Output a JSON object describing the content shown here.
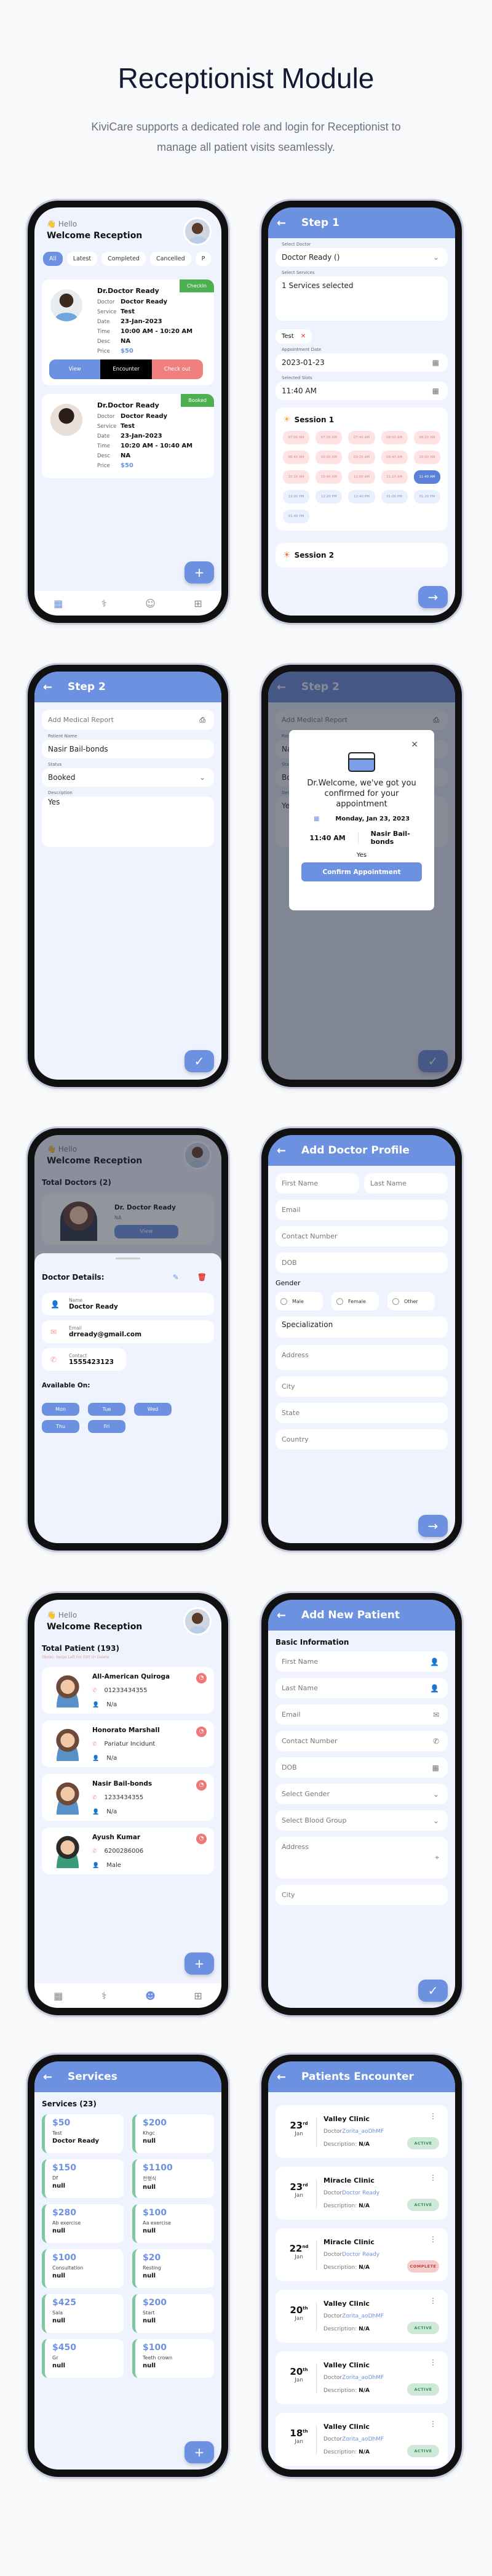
{
  "header": {
    "title": "Receptionist Module",
    "subtitle": "KiviCare supports a dedicated role and login for Receptionist to manage all patient visits seamlessly."
  },
  "colors": {
    "primary": "#6c91e0",
    "success": "#4caf50",
    "danger": "#f08080",
    "background": "#eef3fe"
  },
  "dashboard": {
    "hello": "Hello",
    "welcome": "Welcome Reception",
    "filters": [
      "All",
      "Latest",
      "Completed",
      "Cancelled",
      "P"
    ],
    "active_filter": "All",
    "appointments": [
      {
        "badge": "CheckIn",
        "name": "Dr.Doctor Ready",
        "doctor_label": "Doctor",
        "doctor": "Doctor Ready",
        "service_label": "Service",
        "service": "Test",
        "date_label": "Date",
        "date": "23-Jan-2023",
        "time_label": "Time",
        "time": "10:00 AM - 10:20 AM",
        "desc_label": "Desc",
        "desc": "NA",
        "price_label": "Price",
        "price": "$50"
      },
      {
        "badge": "Booked",
        "name": "Dr.Doctor Ready",
        "doctor_label": "Doctor",
        "doctor": "Doctor Ready",
        "service_label": "Service",
        "service": "Test",
        "date_label": "Date",
        "date": "23-Jan-2023",
        "time_label": "Time",
        "time": "10:20 AM - 10:40 AM",
        "desc_label": "Desc",
        "desc": "NA",
        "price_label": "Price",
        "price": "$50"
      }
    ],
    "actions": {
      "view": "View",
      "encounter": "Encounter",
      "checkout": "Check out"
    },
    "fab": "+"
  },
  "step1": {
    "title": "Step 1",
    "doctor_label": "Select Doctor",
    "doctor_value": "Doctor Ready ()",
    "services_label": "Select Services",
    "services_value": "1 Services selected",
    "service_chip": "Test",
    "date_label": "Appointment Date",
    "date_value": "2023-01-23",
    "slot_label": "Selected Slots",
    "slot_value": "11:40 AM",
    "session1": "Session 1",
    "session2": "Session 2",
    "slots": [
      {
        "t": "07:00 AM",
        "s": "booked"
      },
      {
        "t": "07:20 AM",
        "s": "booked"
      },
      {
        "t": "07:40 AM",
        "s": "booked"
      },
      {
        "t": "08:00 AM",
        "s": "booked"
      },
      {
        "t": "08:20 AM",
        "s": "booked"
      },
      {
        "t": "08:40 AM",
        "s": "booked"
      },
      {
        "t": "09:00 AM",
        "s": "booked"
      },
      {
        "t": "09:20 AM",
        "s": "booked"
      },
      {
        "t": "09:40 AM",
        "s": "booked"
      },
      {
        "t": "10:00 AM",
        "s": "booked"
      },
      {
        "t": "10:20 AM",
        "s": "booked"
      },
      {
        "t": "10:40 AM",
        "s": "booked"
      },
      {
        "t": "11:00 AM",
        "s": "booked"
      },
      {
        "t": "11:20 AM",
        "s": "booked"
      },
      {
        "t": "11:40 AM",
        "s": "selected"
      },
      {
        "t": "12:00 PM",
        "s": "free"
      },
      {
        "t": "12:20 PM",
        "s": "free"
      },
      {
        "t": "12:40 PM",
        "s": "free"
      },
      {
        "t": "01:00 PM",
        "s": "free"
      },
      {
        "t": "01:20 PM",
        "s": "free"
      },
      {
        "t": "01:40 PM",
        "s": "free"
      }
    ]
  },
  "step2": {
    "title": "Step 2",
    "report": "Add Medical Report",
    "patient_label": "Patient Name",
    "patient_value": "Nasir Bail-bonds",
    "status_label": "Status",
    "status_value": "Booked",
    "desc_label": "Description",
    "desc_value": "Yes"
  },
  "confirm_modal": {
    "message": "Dr.Welcome, we've got you confirmed for your appointment",
    "date": "Monday, Jan 23, 2023",
    "time": "11:40 AM",
    "patient": "Nasir Bail-bonds",
    "desc": "Yes",
    "button": "Confirm Appointment"
  },
  "doctors": {
    "total": "Total Doctors (2)",
    "card_name": "Dr. Doctor Ready",
    "card_sub": "NA",
    "view": "View",
    "details_title": "Doctor Details:",
    "name_label": "Name",
    "name": "Doctor Ready",
    "email_label": "Email",
    "email": "drready@gmail.com",
    "contact_label": "Contact",
    "contact": "1555423123",
    "available": "Available On:",
    "days": [
      "Mon",
      "Tue",
      "Wed",
      "Thu",
      "Fri"
    ]
  },
  "add_doctor": {
    "title": "Add Doctor Profile",
    "first": "First Name",
    "last": "Last Name",
    "email": "Email",
    "contact": "Contact Number",
    "dob": "DOB",
    "gender": "Gender",
    "genders": [
      "Male",
      "Female",
      "Other"
    ],
    "specialization": "Specialization",
    "address": "Address",
    "city": "City",
    "state": "State",
    "country": "Country"
  },
  "patients": {
    "total": "Total Patient (193)",
    "note": "(Note): Swipe Left For Edit Or Delete",
    "list": [
      {
        "name": "All-American Quiroga",
        "phone": "01233434355",
        "gender": "N/a"
      },
      {
        "name": "Honorato Marshall",
        "phone": "Pariatur Incidunt",
        "gender": "N/a"
      },
      {
        "name": "Nasir Bail-bonds",
        "phone": "1233434355",
        "gender": "N/a"
      },
      {
        "name": "Ayush Kumar",
        "phone": "6200286006",
        "gender": "Male"
      }
    ]
  },
  "add_patient": {
    "title": "Add New Patient",
    "section": "Basic Information",
    "fields": [
      "First Name",
      "Last Name",
      "Email",
      "Contact Number",
      "DOB",
      "Select Gender",
      "Select Blood Group",
      "Address",
      "City"
    ]
  },
  "services": {
    "title": "Services",
    "count": "Services (23)",
    "list": [
      {
        "price": "$50",
        "name": "Test",
        "doctor": "Doctor Ready"
      },
      {
        "price": "$200",
        "name": "Khgc",
        "doctor": "null"
      },
      {
        "price": "$150",
        "name": "Df",
        "doctor": "null"
      },
      {
        "price": "$1100",
        "name": "전형식",
        "doctor": "null"
      },
      {
        "price": "$280",
        "name": "Ab exercise",
        "doctor": "null"
      },
      {
        "price": "$100",
        "name": "Aa exercise",
        "doctor": "null"
      },
      {
        "price": "$100",
        "name": "Consultation",
        "doctor": "null"
      },
      {
        "price": "$20",
        "name": "Resting",
        "doctor": "null"
      },
      {
        "price": "$425",
        "name": "Sala",
        "doctor": "null"
      },
      {
        "price": "$200",
        "name": "Start",
        "doctor": "null"
      },
      {
        "price": "$450",
        "name": "Gr",
        "doctor": "null"
      },
      {
        "price": "$100",
        "name": "Teeth crown",
        "doctor": "null"
      }
    ]
  },
  "encounters": {
    "title": "Patients Encounter",
    "doctor_label": "Doctor",
    "desc_label": "Description:",
    "list": [
      {
        "day": "23",
        "suffix": "rd",
        "month": "Jan",
        "clinic": "Valley Clinic",
        "doctor": "Zorita_aoDhMF",
        "desc": "N/A",
        "status": "ACTIVE"
      },
      {
        "day": "23",
        "suffix": "rd",
        "month": "Jan",
        "clinic": "Miracle Clinic",
        "doctor": "Doctor Ready",
        "desc": "N/A",
        "status": "ACTIVE"
      },
      {
        "day": "22",
        "suffix": "nd",
        "month": "Jan",
        "clinic": "Miracle Clinic",
        "doctor": "Doctor Ready",
        "desc": "N/A",
        "status": "COMPLETE"
      },
      {
        "day": "20",
        "suffix": "th",
        "month": "Jan",
        "clinic": "Valley Clinic",
        "doctor": "Zorita_aoDhMF",
        "desc": "N/A",
        "status": "ACTIVE"
      },
      {
        "day": "20",
        "suffix": "th",
        "month": "Jan",
        "clinic": "Valley Clinic",
        "doctor": "Zorita_aoDhMF",
        "desc": "N/A",
        "status": "ACTIVE"
      },
      {
        "day": "18",
        "suffix": "th",
        "month": "Jan",
        "clinic": "Valley Clinic",
        "doctor": "Zorita_aoDhMF",
        "desc": "N/A",
        "status": "ACTIVE"
      }
    ]
  }
}
